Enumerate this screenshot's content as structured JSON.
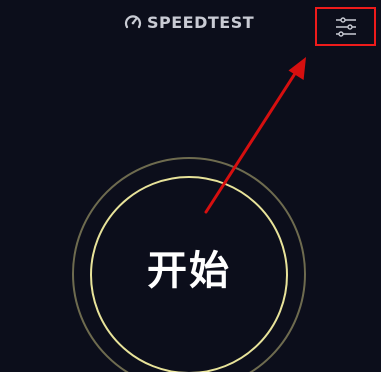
{
  "header": {
    "logo_text": "SPEEDTEST",
    "logo_icon": "speedometer-icon",
    "settings_icon": "settings-sliders-icon"
  },
  "main": {
    "start_label": "开始"
  },
  "colors": {
    "background": "#0c0e1b",
    "highlight_box": "#ef1b1b",
    "arrow": "#d60f0f",
    "ring_outer": "#6e6b4f",
    "ring_inner": "#e8e39a"
  }
}
